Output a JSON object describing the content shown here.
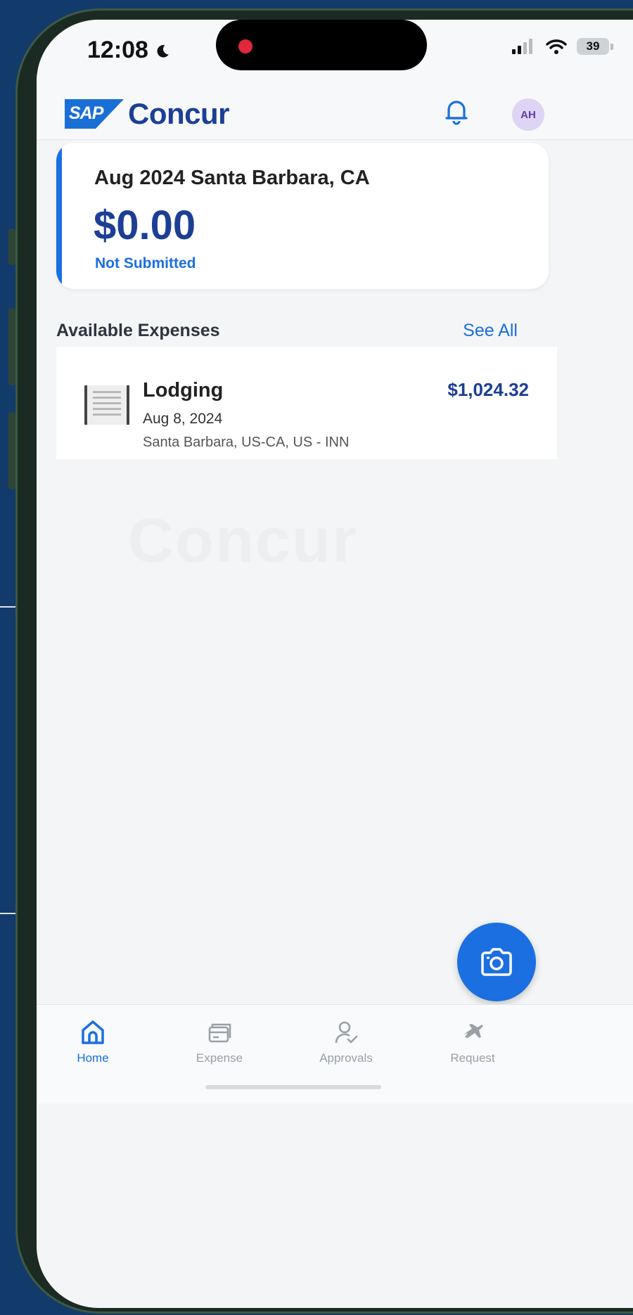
{
  "status_bar": {
    "time": "12:08",
    "battery": "39"
  },
  "header": {
    "brand_sap": "SAP",
    "brand_name": "Concur",
    "avatar_initials": "AH"
  },
  "report": {
    "title": "Aug 2024 Santa Barbara, CA",
    "amount": "$0.00",
    "status": "Not Submitted"
  },
  "available_expenses": {
    "section_title": "Available Expenses",
    "see_all_label": "See All",
    "items": [
      {
        "name": "Lodging",
        "date": "Aug 8, 2024",
        "location": "Santa Barbara, US-CA, US - INN",
        "amount": "$1,024.32"
      }
    ]
  },
  "tab_bar": {
    "tabs": [
      {
        "label": "Home",
        "icon": "home-icon",
        "active": true
      },
      {
        "label": "Expense",
        "icon": "card-icon",
        "active": false
      },
      {
        "label": "Approvals",
        "icon": "user-check-icon",
        "active": false
      },
      {
        "label": "Request",
        "icon": "plane-icon",
        "active": false
      }
    ]
  },
  "colors": {
    "accent": "#1b6fe0",
    "brand_navy": "#1c3f95",
    "background": "#f4f5f6"
  }
}
